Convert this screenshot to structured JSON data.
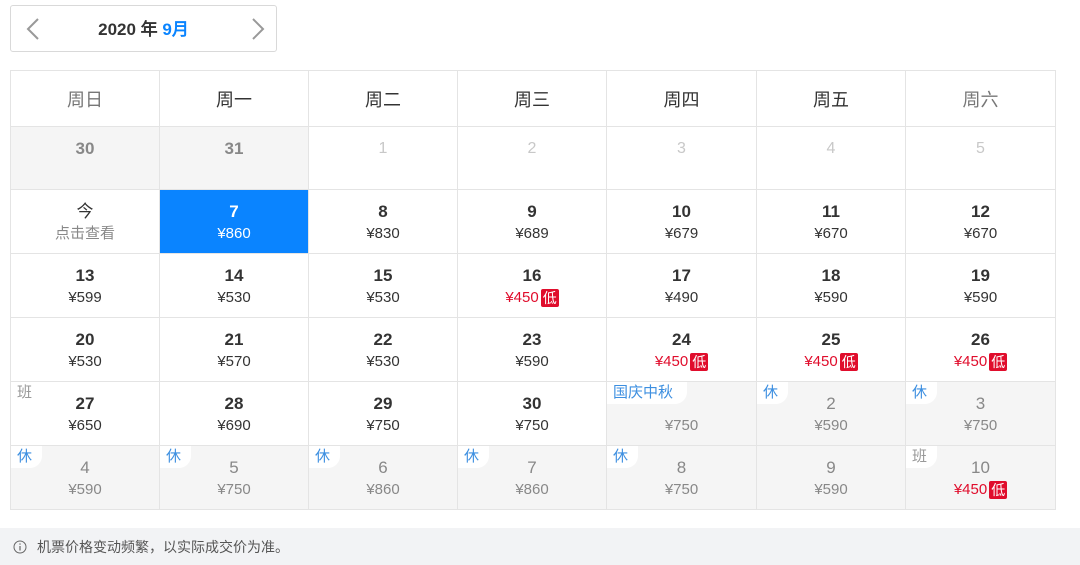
{
  "month_nav": {
    "year_text": "2020 年 ",
    "month_text": "9月"
  },
  "weekdays": [
    "周日",
    "周一",
    "周二",
    "周三",
    "周四",
    "周五",
    "周六"
  ],
  "low_badge": "低",
  "weeks": [
    [
      {
        "day": "30",
        "price": "",
        "state": "prev-month"
      },
      {
        "day": "31",
        "price": "",
        "state": "prev-month"
      },
      {
        "day": "1",
        "price": "",
        "state": "next-month"
      },
      {
        "day": "2",
        "price": "",
        "state": "next-month"
      },
      {
        "day": "3",
        "price": "",
        "state": "next-month"
      },
      {
        "day": "4",
        "price": "",
        "state": "next-month"
      },
      {
        "day": "5",
        "price": "",
        "state": "next-month"
      }
    ],
    [
      {
        "day": "今",
        "price": "点击查看",
        "state": "today"
      },
      {
        "day": "7",
        "price": "¥860",
        "state": "selected"
      },
      {
        "day": "8",
        "price": "¥830"
      },
      {
        "day": "9",
        "price": "¥689"
      },
      {
        "day": "10",
        "price": "¥679"
      },
      {
        "day": "11",
        "price": "¥670"
      },
      {
        "day": "12",
        "price": "¥670"
      }
    ],
    [
      {
        "day": "13",
        "price": "¥599"
      },
      {
        "day": "14",
        "price": "¥530"
      },
      {
        "day": "15",
        "price": "¥530"
      },
      {
        "day": "16",
        "price": "¥450",
        "low": true
      },
      {
        "day": "17",
        "price": "¥490"
      },
      {
        "day": "18",
        "price": "¥590"
      },
      {
        "day": "19",
        "price": "¥590"
      }
    ],
    [
      {
        "day": "20",
        "price": "¥530"
      },
      {
        "day": "21",
        "price": "¥570"
      },
      {
        "day": "22",
        "price": "¥530"
      },
      {
        "day": "23",
        "price": "¥590"
      },
      {
        "day": "24",
        "price": "¥450",
        "low": true
      },
      {
        "day": "25",
        "price": "¥450",
        "low": true
      },
      {
        "day": "26",
        "price": "¥450",
        "low": true
      }
    ],
    [
      {
        "day": "27",
        "price": "¥650",
        "tag": "班",
        "tag_type": "work"
      },
      {
        "day": "28",
        "price": "¥690"
      },
      {
        "day": "29",
        "price": "¥750"
      },
      {
        "day": "30",
        "price": "¥750"
      },
      {
        "day": "",
        "price": "¥750",
        "state": "next-month-gray",
        "tag": "国庆中秋",
        "tag_type": "holiday"
      },
      {
        "day": "2",
        "price": "¥590",
        "state": "next-month-gray",
        "tag": "休",
        "tag_type": "rest"
      },
      {
        "day": "3",
        "price": "¥750",
        "state": "next-month-gray",
        "tag": "休",
        "tag_type": "rest"
      }
    ],
    [
      {
        "day": "4",
        "price": "¥590",
        "state": "next-month-gray",
        "tag": "休",
        "tag_type": "rest"
      },
      {
        "day": "5",
        "price": "¥750",
        "state": "next-month-gray",
        "tag": "休",
        "tag_type": "rest"
      },
      {
        "day": "6",
        "price": "¥860",
        "state": "next-month-gray",
        "tag": "休",
        "tag_type": "rest"
      },
      {
        "day": "7",
        "price": "¥860",
        "state": "next-month-gray",
        "tag": "休",
        "tag_type": "rest"
      },
      {
        "day": "8",
        "price": "¥750",
        "state": "next-month-gray",
        "tag": "休",
        "tag_type": "rest"
      },
      {
        "day": "9",
        "price": "¥590",
        "state": "next-month-gray"
      },
      {
        "day": "10",
        "price": "¥450",
        "state": "next-month-gray",
        "low": true,
        "tag": "班",
        "tag_type": "work"
      }
    ]
  ],
  "notice": {
    "text": "机票价格变动频繁，以实际成交价为准。"
  },
  "colors": {
    "accent": "#0a84ff",
    "low_price": "#e00d2c",
    "rest_tag": "#3d8fe0"
  }
}
